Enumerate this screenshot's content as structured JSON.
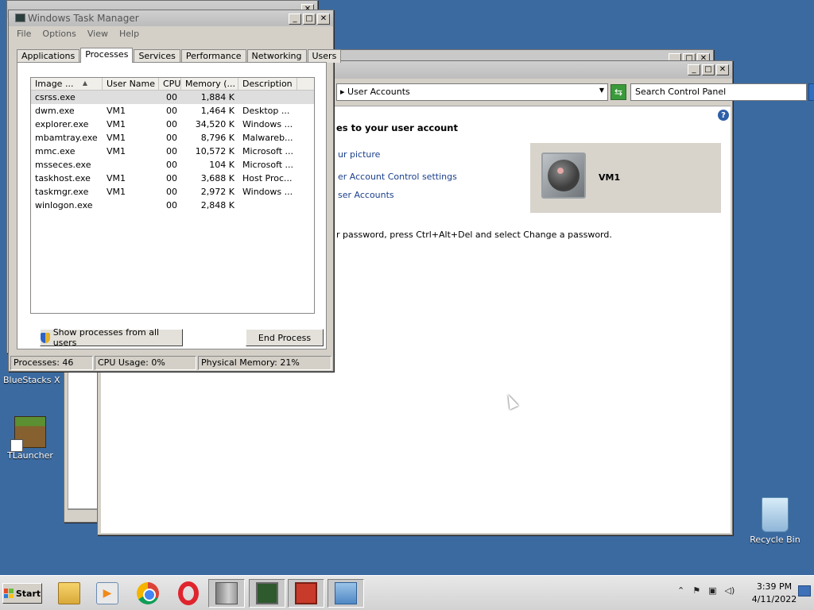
{
  "task_manager": {
    "title": "Windows Task Manager",
    "menu": [
      "File",
      "Options",
      "View",
      "Help"
    ],
    "tabs": [
      "Applications",
      "Processes",
      "Services",
      "Performance",
      "Networking",
      "Users"
    ],
    "active_tab": "Processes",
    "columns": [
      "Image ...",
      "User Name",
      "CPU",
      "Memory (...",
      "Description"
    ],
    "rows": [
      {
        "image": "csrss.exe",
        "user": "",
        "cpu": "00",
        "memory": "1,884 K",
        "description": ""
      },
      {
        "image": "dwm.exe",
        "user": "VM1",
        "cpu": "00",
        "memory": "1,464 K",
        "description": "Desktop ..."
      },
      {
        "image": "explorer.exe",
        "user": "VM1",
        "cpu": "00",
        "memory": "34,520 K",
        "description": "Windows ..."
      },
      {
        "image": "mbamtray.exe",
        "user": "VM1",
        "cpu": "00",
        "memory": "8,796 K",
        "description": "Malwareb..."
      },
      {
        "image": "mmc.exe",
        "user": "VM1",
        "cpu": "00",
        "memory": "10,572 K",
        "description": "Microsoft ..."
      },
      {
        "image": "msseces.exe",
        "user": "",
        "cpu": "00",
        "memory": "104 K",
        "description": "Microsoft ..."
      },
      {
        "image": "taskhost.exe",
        "user": "VM1",
        "cpu": "00",
        "memory": "3,688 K",
        "description": "Host Proc..."
      },
      {
        "image": "taskmgr.exe",
        "user": "VM1",
        "cpu": "00",
        "memory": "2,972 K",
        "description": "Windows ..."
      },
      {
        "image": "winlogon.exe",
        "user": "",
        "cpu": "00",
        "memory": "2,848 K",
        "description": ""
      }
    ],
    "show_all_button": "Show processes from all users",
    "end_process_button": "End Process",
    "status": {
      "processes": "Processes: 46",
      "cpu": "CPU Usage: 0%",
      "memory": "Physical Memory: 21%"
    }
  },
  "control_panel": {
    "address": "▸  User Accounts",
    "search_placeholder": "Search Control Panel",
    "heading": "es to your user account",
    "links": [
      "ur picture",
      "er Account Control settings",
      "ser Accounts"
    ],
    "note": "r password, press Ctrl+Alt+Del and select Change a password.",
    "user_name": "VM1"
  },
  "desktop": {
    "icons": [
      "BlueStacks X",
      "TLauncher",
      "Recycle Bin"
    ]
  },
  "taskbar": {
    "start_label": "Start",
    "apps": [
      "folder-icon",
      "media-player-icon",
      "chrome-icon",
      "opera-icon",
      "server-manager-icon",
      "network-monitor-icon",
      "toolbox-icon",
      "control-panel-icon"
    ],
    "clock_time": "3:39 PM",
    "clock_date": "4/11/2022"
  }
}
